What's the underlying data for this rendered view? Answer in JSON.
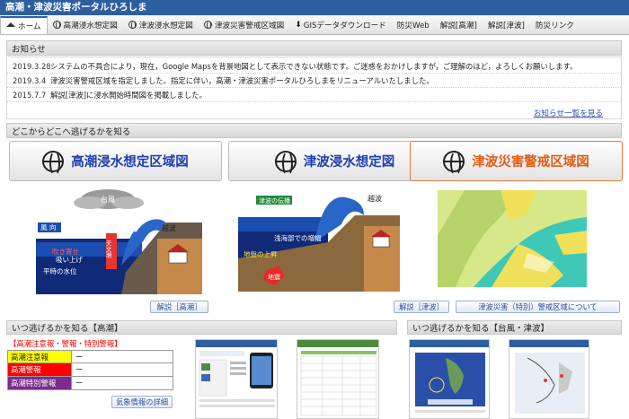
{
  "title": "高潮・津波災害ポータルひろしま",
  "nav": [
    {
      "label": "ホーム",
      "icon": "home-icon"
    },
    {
      "label": "高潮浸水想定図",
      "icon": "globe-icon"
    },
    {
      "label": "津波浸水想定図",
      "icon": "globe-icon"
    },
    {
      "label": "津波災害警戒区域図",
      "icon": "globe-icon"
    },
    {
      "label": "GISデータダウンロード",
      "icon": "download-icon"
    },
    {
      "label": "防災Web",
      "icon": ""
    },
    {
      "label": "解説[高潮]",
      "icon": ""
    },
    {
      "label": "解説[津波]",
      "icon": ""
    },
    {
      "label": "防災リンク",
      "icon": ""
    }
  ],
  "notices": {
    "heading": "お知らせ",
    "items": [
      {
        "date": "2019.3.28",
        "text": "システムの不具合により，現在，Google Mapsを背景地図として表示できない状態です。ご迷惑をおかけしますが，ご理解のほど，よろしくお願いします。"
      },
      {
        "date": "2019.3.4",
        "text": "津波災害警戒区域を指定しました。指定に伴い，高潮・津波災害ポータルひろしまをリニューアルいたしました。"
      },
      {
        "date": "2015.7.7",
        "text": "解説[津波]に浸水開始時間図を掲載しました。"
      }
    ],
    "more_link": "お知らせ一覧を見る"
  },
  "where": {
    "heading": "どこからどこへ逃げるかを知る",
    "cards": [
      {
        "label": "高潮浸水想定区域図"
      },
      {
        "label": "津波浸水想定図"
      },
      {
        "label": "津波災害警戒区域図"
      }
    ]
  },
  "illus_storm": {
    "typhoon": "台風",
    "wind": "風 向",
    "overtopping": "越波",
    "blow": "吹き寄せ",
    "suck": "吸い上げ",
    "astro": "天文潮",
    "normal": "平時の水位"
  },
  "illus_tsunami": {
    "propagation": "津波の伝播",
    "rise": "海面の上昇",
    "shallow": "浅海部での増幅",
    "overtopping": "越波",
    "crust": "地盤の上昇",
    "quake": "地震"
  },
  "buttons": {
    "explain_storm": "解説［高潮］",
    "explain_tsunami": "解説［津波］",
    "warning_about": "津波災害（特別）警戒区域について",
    "weather_detail": "気象情報の詳細"
  },
  "when_storm": {
    "heading": "いつ逃げるかを知る【高潮】",
    "subtitle": "【高潮注意報・警報・特別警報】",
    "rows": [
      {
        "label": "高潮注意報",
        "value": "ー",
        "color": "#ffff00",
        "text_color": "#222222"
      },
      {
        "label": "高潮警報",
        "value": "ー",
        "color": "#ff0000",
        "text_color": "#ffffff"
      },
      {
        "label": "高潮特別警報",
        "value": "ー",
        "color": "#7b2c8e",
        "text_color": "#ffffff"
      }
    ]
  },
  "when_typhoon": {
    "heading": "いつ逃げるかを知る【台風・津波】"
  },
  "colors": {
    "accent": "#2d5fa0",
    "storm_title": "#1e3fb0",
    "warning_title": "#e35b13"
  }
}
